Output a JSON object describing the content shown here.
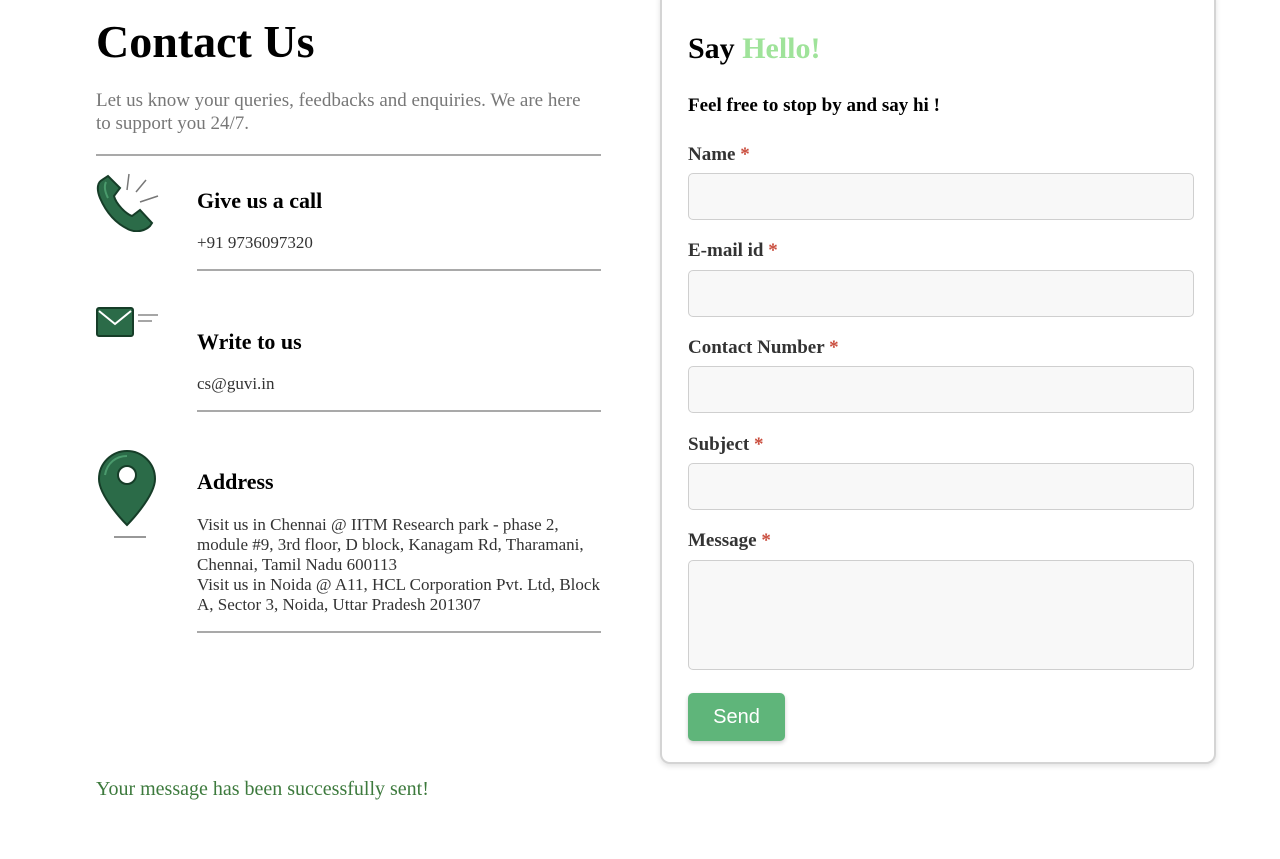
{
  "header": {
    "title": "Contact Us",
    "intro": "Let us know your queries, feedbacks and enquiries. We are here to support you 24/7."
  },
  "contacts": [
    {
      "icon": "phone-icon",
      "heading": "Give us a call",
      "text": "+91 9736097320"
    },
    {
      "icon": "mail-icon",
      "heading": "Write to us",
      "text": "cs@guvi.in"
    },
    {
      "icon": "location-pin-icon",
      "heading": "Address",
      "line1": "Visit us in Chennai @ IITM Research park - phase 2, module #9, 3rd floor, D block, Kanagam Rd, Tharamani, Chennai, Tamil Nadu 600113",
      "line2": "Visit us in Noida @ A11, HCL Corporation Pvt. Ltd, Block A, Sector 3, Noida, Uttar Pradesh 201307"
    }
  ],
  "status": {
    "success_message": "Your message has been successfully sent!"
  },
  "form": {
    "title_prefix": "Say ",
    "title_accent": "Hello!",
    "subtitle": "Feel free to stop by and say hi !",
    "required_mark": "*",
    "fields": [
      {
        "label": "Name",
        "value": ""
      },
      {
        "label": "E-mail id",
        "value": ""
      },
      {
        "label": "Contact Number",
        "value": ""
      },
      {
        "label": "Subject",
        "value": ""
      },
      {
        "label": "Message",
        "value": ""
      }
    ],
    "send_label": "Send"
  },
  "colors": {
    "icon_green": "#2b6b48",
    "accent_hello": "#9fe39a",
    "send_button": "#5fb57a",
    "success_text": "#3d7a3d",
    "required": "#c94b3b"
  }
}
